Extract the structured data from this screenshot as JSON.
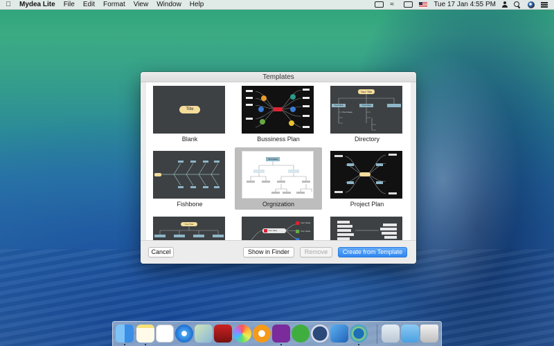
{
  "menubar": {
    "app_name": "Mydea Lite",
    "menus": [
      "File",
      "Edit",
      "Format",
      "View",
      "Window",
      "Help"
    ],
    "clock": "Tue 17 Jan  4:55 PM"
  },
  "dialog": {
    "title": "Templates",
    "templates": [
      {
        "label": "Blank",
        "selected": false,
        "thumb_title": "Title"
      },
      {
        "label": "Bussiness Plan",
        "selected": false
      },
      {
        "label": "Directory",
        "selected": false,
        "thumb_title": "Your Title",
        "nodes": [
          "Your Idea",
          "Your Idea",
          "Text Ideas"
        ]
      },
      {
        "label": "Fishbone",
        "selected": false
      },
      {
        "label": "Orgnization",
        "selected": true,
        "thumb_title": "Test Ideas"
      },
      {
        "label": "Project Plan",
        "selected": false
      },
      {
        "label": "",
        "selected": false,
        "thumb_title": "Your Title"
      },
      {
        "label": "",
        "selected": false,
        "nodes": [
          "Your Idea",
          "Your Ideas",
          "Your Ideas"
        ]
      },
      {
        "label": "",
        "selected": false
      }
    ],
    "buttons": {
      "cancel": "Cancel",
      "show_in_finder": "Show in Finder",
      "remove": "Remove",
      "create": "Create from Template"
    }
  },
  "dock": {
    "apps": [
      "finder-icon",
      "notes-icon",
      "reminders-icon",
      "safari-icon",
      "preview-icon",
      "photo-booth-icon",
      "photos-icon",
      "ibooks-icon",
      "onenote-icon",
      "evernote-icon",
      "sourcetree-icon",
      "xcode-icon",
      "mydea-icon",
      "downloads-folder-icon",
      "documents-folder-icon",
      "trash-icon"
    ]
  },
  "colors": {
    "primary_button": "#2f87f0",
    "selected_tile": "#bdbdbd",
    "thumb_dark": "#3d4144"
  }
}
